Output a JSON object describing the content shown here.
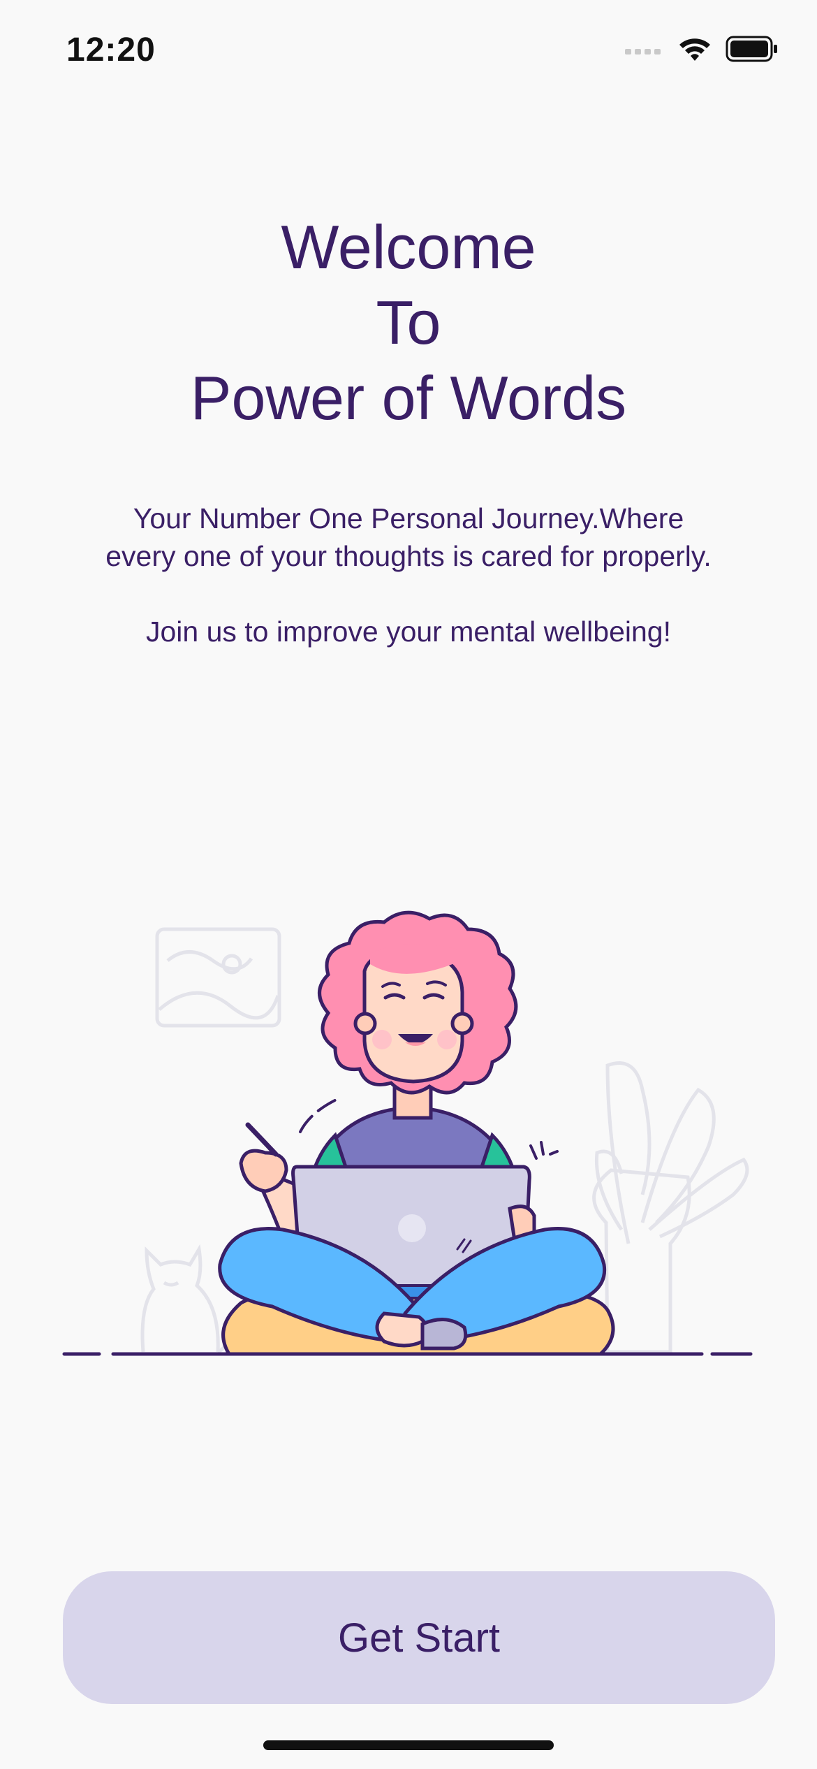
{
  "status_bar": {
    "time": "12:20",
    "icons": [
      "signal-icon",
      "wifi-icon",
      "battery-icon"
    ]
  },
  "welcome": {
    "title_lines": [
      "Welcome",
      "To",
      "Power of Words"
    ],
    "description": "Your Number One Personal Journey.Where every one of your thoughts is cared for properly.",
    "tagline": "Join us to improve your mental wellbeing!"
  },
  "illustration": {
    "name": "person-with-laptop-illustration"
  },
  "actions": {
    "get_start_label": "Get Start"
  },
  "colors": {
    "primary_text": "#3a1f66",
    "button_bg": "#d8d5eb",
    "background": "#f9f9f9",
    "hair": "#ff8fb1",
    "pants": "#5bb8ff",
    "shirt": "#7b78c0",
    "cushion": "#ffcf87"
  }
}
